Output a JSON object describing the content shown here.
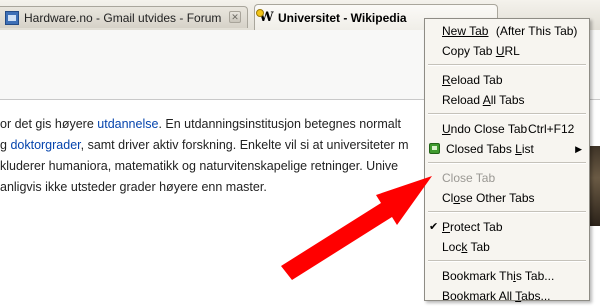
{
  "tabs": [
    {
      "title": "Hardware.no - Gmail utvides - Forum",
      "favicon": "hardware-favicon-icon",
      "active": false
    },
    {
      "title": "Universitet - Wikipedia",
      "favicon": "wikipedia-favicon-icon",
      "active": true
    }
  ],
  "tab_close_glyph": "✕",
  "article_lines": [
    {
      "parts": [
        {
          "text": "or det gis høyere ",
          "link": false
        },
        {
          "text": "utdannelse",
          "link": true
        },
        {
          "text": ". En utdanningsinstitusjon betegnes normalt",
          "link": false
        }
      ]
    },
    {
      "parts": [
        {
          "text": "g ",
          "link": false
        },
        {
          "text": "doktorgrader",
          "link": true
        },
        {
          "text": ", samt driver aktiv forskning. Enkelte vil si at universiteter m",
          "link": false
        }
      ]
    },
    {
      "parts": [
        {
          "text": "kluderer humaniora, matematikk og naturvitenskapelige retninger. Unive",
          "link": false
        }
      ]
    },
    {
      "parts": [
        {
          "text": "anligvis ikke utsteder grader høyere enn master.",
          "link": false
        }
      ]
    }
  ],
  "menu": {
    "new_tab": "New Tab",
    "new_tab_hint": "(After This Tab)",
    "copy_tab_url_pre": "Copy Tab ",
    "copy_tab_url_ul": "U",
    "copy_tab_url_post": "RL",
    "reload_tab_ul": "R",
    "reload_tab_post": "eload Tab",
    "reload_all_pre": "Reload ",
    "reload_all_ul": "A",
    "reload_all_post": "ll Tabs",
    "undo_close_ul": "U",
    "undo_close_post": "ndo Close Tab",
    "undo_close_accel": "Ctrl+F12",
    "closed_tabs_pre": "Closed Tabs ",
    "closed_tabs_ul": "L",
    "closed_tabs_post": "ist",
    "submenu_arrow": "▶",
    "close_tab": "Close Tab",
    "close_other_pre": "Cl",
    "close_other_ul": "o",
    "close_other_post": "se Other Tabs",
    "check_glyph": "✔",
    "protect_ul": "P",
    "protect_post": "rotect Tab",
    "lock_pre": "Loc",
    "lock_ul": "k",
    "lock_post": " Tab",
    "bookmark_tab_pre": "Bookmark Th",
    "bookmark_tab_ul": "i",
    "bookmark_tab_post": "s Tab...",
    "bookmark_all_pre": "Bookmark All ",
    "bookmark_all_ul": "T",
    "bookmark_all_post": "abs..."
  },
  "colors": {
    "link": "#0645ad",
    "annotation_arrow": "#ff0000",
    "menu_background": "#f7f5f0",
    "disabled_text": "#9a9893"
  }
}
